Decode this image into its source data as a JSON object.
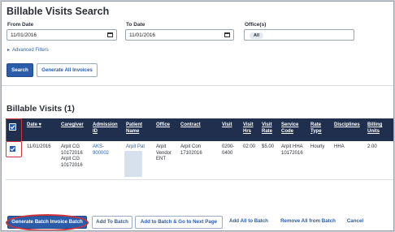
{
  "page": {
    "title": "Billable Visits Search"
  },
  "filters": {
    "from_date_label": "From Date",
    "from_date_value": "11/01/2016",
    "to_date_label": "To Date",
    "to_date_value": "11/01/2016",
    "offices_label": "Office(s)",
    "offices_chip": "All",
    "advanced_filters": "Advanced Filters"
  },
  "actions": {
    "search": "Search",
    "generate_all_invoices": "Generate All Invoices"
  },
  "results": {
    "title": "Billable Visits (1)",
    "columns": {
      "date": "Date",
      "caregiver": "Caregiver",
      "admission_id": "Admission ID",
      "patient_name": "Patient Name",
      "office": "Office",
      "contract": "Contract",
      "visit": "Visit",
      "visit_hrs": "Visit Hrs",
      "visit_rate": "Visit Rate",
      "service_code": "Service Code",
      "rate_type": "Rate Type",
      "disciplines": "Disciplines",
      "billing_units": "Billing Units"
    },
    "rows": [
      {
        "checked": true,
        "date": "11/01/2016",
        "caregiver": "Arpit CG 10172016 Arpit CG 10172016",
        "admission_id": "AKS-900002",
        "patient_name": "Arpit Pat",
        "office": "Arpit Vendor ENT",
        "contract": "Arpit Con 17102016",
        "visit": "0200-0400",
        "visit_hrs": "02:00",
        "visit_rate": "$5.00",
        "service_code": "Arpit HHA 10172016",
        "rate_type": "Hourly",
        "disciplines": "HHA",
        "billing_units": "2.00"
      }
    ]
  },
  "footer": {
    "generate_batch_invoice": "Generate Batch Invoice Batch",
    "add_to_batch": "Add To Batch",
    "add_to_batch_next": "Add to Batch & Go to Next Page",
    "add_all_to_batch": "Add All to Batch",
    "remove_all_from_batch": "Remove All from Batch",
    "cancel": "Cancel"
  },
  "colors": {
    "primary": "#2a5caa",
    "table_header": "#1f2f4d",
    "highlight": "#d1343a",
    "link": "#2a64b8"
  }
}
